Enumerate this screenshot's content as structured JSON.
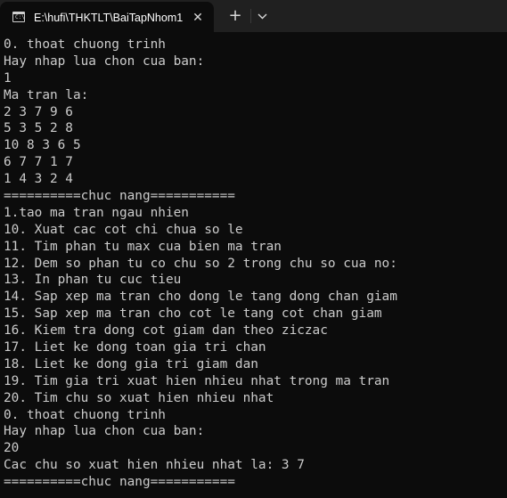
{
  "window": {
    "tab_title": "E:\\hufi\\THKTLT\\BaiTapNhom1",
    "tab_icon_glyph": "C:\\",
    "close_glyph": "✕",
    "new_tab_glyph": "+"
  },
  "console": {
    "lines": [
      "0. thoat chuong trinh",
      "Hay nhap lua chon cua ban:",
      "1",
      "Ma tran la:",
      "2 3 7 9 6",
      "5 3 5 2 8",
      "10 8 3 6 5",
      "6 7 7 1 7",
      "1 4 3 2 4",
      "==========chuc nang===========",
      "1.tao ma tran ngau nhien",
      "10. Xuat cac cot chi chua so le",
      "11. Tim phan tu max cua bien ma tran",
      "12. Dem so phan tu co chu so 2 trong chu so cua no:",
      "13. In phan tu cuc tieu",
      "14. Sap xep ma tran cho dong le tang dong chan giam",
      "15. Sap xep ma tran cho cot le tang cot chan giam",
      "16. Kiem tra dong cot giam dan theo ziczac",
      "17. Liet ke dong toan gia tri chan",
      "18. Liet ke dong gia tri giam dan",
      "19. Tim gia tri xuat hien nhieu nhat trong ma tran",
      "20. Tim chu so xuat hien nhieu nhat",
      "0. thoat chuong trinh",
      "Hay nhap lua chon cua ban:",
      "20",
      "Cac chu so xuat hien nhieu nhat la: 3 7",
      "==========chuc nang==========="
    ]
  },
  "colors": {
    "background": "#0c0c0c",
    "tabbar": "#202020",
    "text": "#cccccc"
  },
  "icons": {
    "tab": "terminal-icon",
    "close": "close-icon",
    "new_tab": "plus-icon",
    "dropdown": "chevron-down-icon"
  }
}
